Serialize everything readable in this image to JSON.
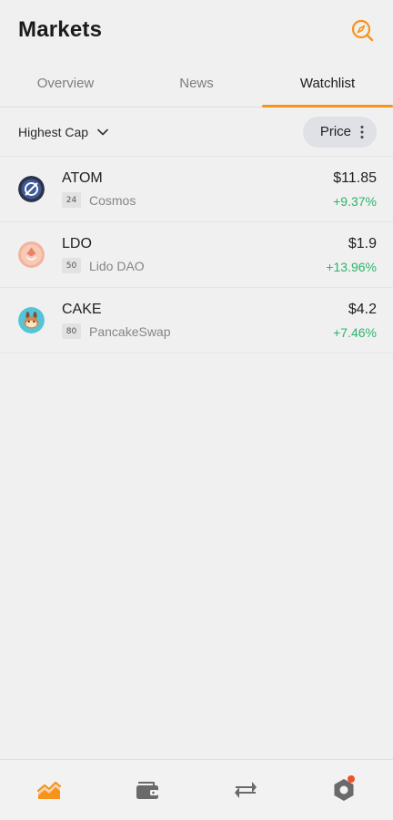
{
  "header": {
    "title": "Markets",
    "search_icon": "search-icon",
    "accent_color": "#f7931a"
  },
  "tabs": [
    {
      "label": "Overview",
      "active": false
    },
    {
      "label": "News",
      "active": false
    },
    {
      "label": "Watchlist",
      "active": true
    }
  ],
  "filter": {
    "sort_label": "Highest Cap",
    "sort_icon": "chevron-down-icon",
    "price_label": "Price",
    "more_icon": "kebab-menu-icon"
  },
  "coins": [
    {
      "symbol": "ATOM",
      "rank": "24",
      "name": "Cosmos",
      "price": "$11.85",
      "change": "+9.37%",
      "icon": "cosmos-logo-icon"
    },
    {
      "symbol": "LDO",
      "rank": "50",
      "name": "Lido DAO",
      "price": "$1.9",
      "change": "+13.96%",
      "icon": "lido-logo-icon"
    },
    {
      "symbol": "CAKE",
      "rank": "80",
      "name": "PancakeSwap",
      "price": "$4.2",
      "change": "+7.46%",
      "icon": "pancakeswap-logo-icon"
    }
  ],
  "positive_color": "#2db46d",
  "bottom_nav": [
    {
      "icon": "markets-chart-icon",
      "active": true
    },
    {
      "icon": "wallet-icon",
      "active": false
    },
    {
      "icon": "swap-arrows-icon",
      "active": false
    },
    {
      "icon": "settings-hexagon-icon",
      "active": false,
      "notification": true
    }
  ]
}
